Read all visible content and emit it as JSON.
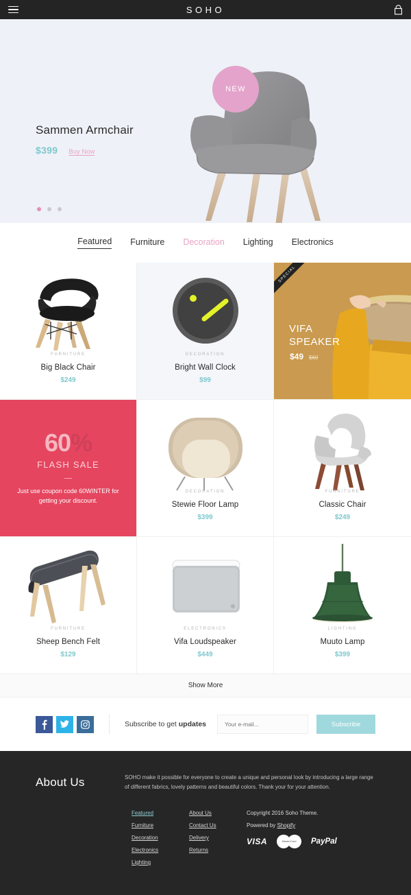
{
  "header": {
    "brand": "SOHO",
    "menu_icon": "hamburger-icon",
    "cart_icon": "shopping-bag-icon"
  },
  "hero": {
    "badge": "NEW",
    "title": "Sammen Armchair",
    "price": "$399",
    "cta": "Buy Now",
    "slides": 3,
    "active_slide": 1
  },
  "tabs": [
    {
      "label": "Featured",
      "state": "active"
    },
    {
      "label": "Furniture",
      "state": "default"
    },
    {
      "label": "Decoration",
      "state": "highlight"
    },
    {
      "label": "Lighting",
      "state": "default"
    },
    {
      "label": "Electronics",
      "state": "default"
    }
  ],
  "products": [
    {
      "category": "FURNITURE",
      "name": "Big Black Chair",
      "price": "$249"
    },
    {
      "category": "DECORATION",
      "name": "Bright Wall Clock",
      "price": "$99"
    },
    {
      "category": "DECORATION",
      "name": "Stewie Floor Lamp",
      "price": "$399"
    },
    {
      "category": "FURNITURE",
      "name": "Classic Chair",
      "price": "$249"
    },
    {
      "category": "FURNITURE",
      "name": "Sheep Bench Felt",
      "price": "$129"
    },
    {
      "category": "ELECTRONICS",
      "name": "Vifa Loudspeaker",
      "price": "$449"
    },
    {
      "category": "LIGHTING",
      "name": "Muuto Lamp",
      "price": "$399"
    }
  ],
  "promo_speaker": {
    "ribbon": "SPECIAL",
    "title_line1": "VIFA",
    "title_line2": "SPEAKER",
    "price": "$49",
    "old_price": "$60"
  },
  "flash_sale": {
    "number": "60",
    "percent": "%",
    "label": "FLASH SALE",
    "description": "Just use coupon code 60WINTER for getting your discount."
  },
  "show_more": "Show More",
  "subscribe": {
    "socials": [
      {
        "name": "facebook-icon",
        "glyph": "f"
      },
      {
        "name": "twitter-icon",
        "glyph": "t"
      },
      {
        "name": "instagram-icon",
        "glyph": "i"
      }
    ],
    "text_plain": "Subscribe to get ",
    "text_bold": "updates",
    "placeholder": "Your e-mail...",
    "button": "Subscribe"
  },
  "footer": {
    "heading": "About Us",
    "description": "SOHO make it possible for everyone to create a unique and personal look by introducing a large range of different fabrics, lovely patterns and beautiful colors. Thank your for your attention.",
    "col1": [
      "Featured",
      "Furniture",
      "Decoration",
      "Electronics",
      "Lighting"
    ],
    "col2": [
      "About Us",
      "Contact Us",
      "Delivery",
      "Returns"
    ],
    "copyright": "Copyright 2016 Soho Theme.",
    "powered_prefix": "Powered by ",
    "powered_link": "Shopify",
    "payments": [
      "VISA",
      "MasterCard",
      "PayPal"
    ],
    "visa_label": "VISA",
    "mc_label": "MasterCard",
    "paypal_label": "PayPal"
  },
  "colors": {
    "dark": "#262626",
    "teal": "#7ec8cd",
    "pink": "#e8a3c4",
    "flash_red": "#e5455f",
    "speaker_tan": "#c99a4f"
  }
}
